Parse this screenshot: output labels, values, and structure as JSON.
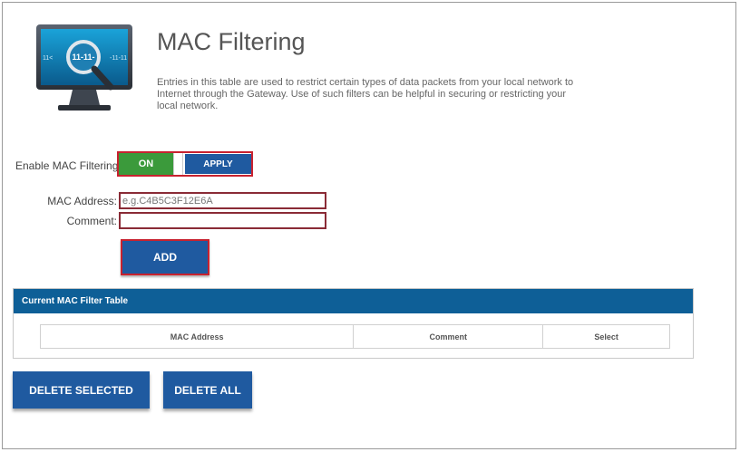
{
  "header": {
    "title": "MAC Filtering",
    "description": "Entries in this table are used to restrict certain types of data packets from your local network to Internet through the Gateway. Use of such filters can be helpful in securing or restricting your local network.",
    "monitor_text": {
      "left": "11<",
      "center": "11-11-",
      "right": "-11-11"
    }
  },
  "filtering": {
    "label": "Enable MAC Filtering",
    "toggle_state": "ON",
    "apply_label": "APPLY"
  },
  "form": {
    "mac_label": "MAC Address:",
    "mac_placeholder": "e.g.C4B5C3F12E6A",
    "comment_label": "Comment:",
    "add_label": "ADD"
  },
  "table": {
    "title": "Current MAC Filter Table",
    "columns": [
      "MAC Address",
      "Comment",
      "Select"
    ]
  },
  "actions": {
    "delete_selected": "DELETE SELECTED",
    "delete_all": "DELETE ALL"
  },
  "colors": {
    "primary_button": "#1f5aa0",
    "table_header": "#0e5f97",
    "toggle_on": "#3b9a3b",
    "highlight_border": "#c8222f"
  }
}
